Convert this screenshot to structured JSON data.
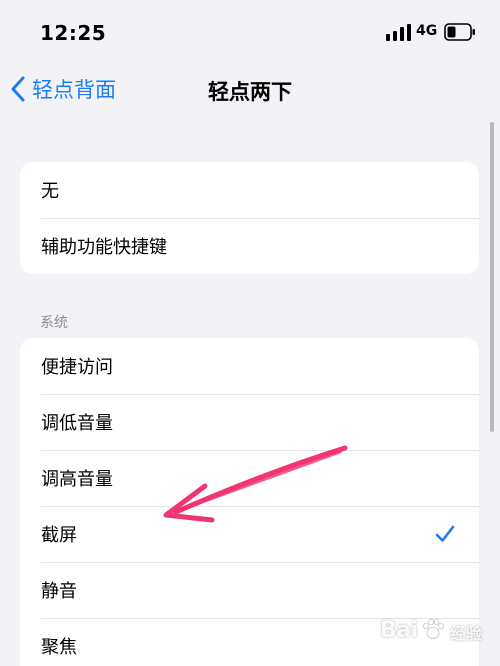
{
  "status_bar": {
    "time": "12:25",
    "network": "4G",
    "icons": [
      "signal-icon",
      "battery-icon"
    ]
  },
  "nav": {
    "back_label": "轻点背面",
    "title": "轻点两下",
    "back_icon": "chevron-left-icon"
  },
  "options_top": [
    {
      "label": "无"
    },
    {
      "label": "辅助功能快捷键"
    }
  ],
  "system": {
    "header": "系统",
    "items": [
      {
        "label": "便捷访问",
        "selected": false
      },
      {
        "label": "调低音量",
        "selected": false
      },
      {
        "label": "调高音量",
        "selected": false
      },
      {
        "label": "截屏",
        "selected": true
      },
      {
        "label": "静音",
        "selected": false
      },
      {
        "label": "聚焦",
        "selected": false
      }
    ]
  },
  "colors": {
    "accent": "#1a7cf7",
    "background": "#f2f2f7",
    "annotation_arrow": "#f0356f"
  },
  "watermark": {
    "text": "Bai",
    "sub": "经验"
  }
}
